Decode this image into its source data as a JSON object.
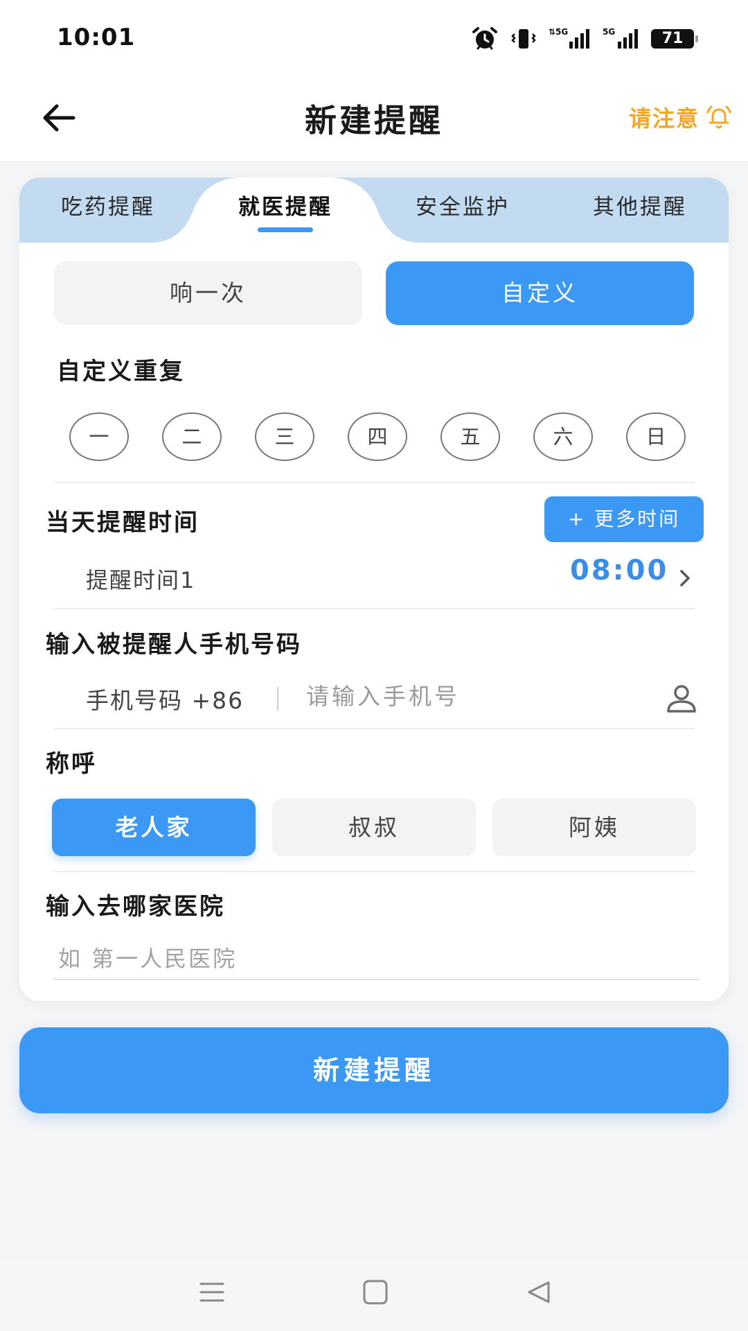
{
  "status_bar": {
    "time": "10:01",
    "icons": [
      "alarm-icon",
      "vibrate-icon",
      "signal-5g-icon",
      "signal-5g-icon"
    ],
    "battery": "71"
  },
  "header": {
    "title": "新建提醒",
    "notice_label": "请注意"
  },
  "tabs": [
    {
      "label": "吃药提醒",
      "active": false
    },
    {
      "label": "就医提醒",
      "active": true
    },
    {
      "label": "安全监护",
      "active": false
    },
    {
      "label": "其他提醒",
      "active": false
    }
  ],
  "repeat_mode": {
    "once_label": "响一次",
    "custom_label": "自定义",
    "selected": "自定义"
  },
  "custom_repeat": {
    "title": "自定义重复",
    "days": [
      "一",
      "二",
      "三",
      "四",
      "五",
      "六",
      "日"
    ]
  },
  "reminder_time": {
    "title": "当天提醒时间",
    "more_button": "+ 更多时间",
    "items": [
      {
        "label": "提醒时间1",
        "value": "08:00"
      }
    ]
  },
  "phone": {
    "title": "输入被提醒人手机号码",
    "prefix": "手机号码 +86",
    "placeholder": "请输入手机号",
    "value": ""
  },
  "salutation": {
    "title": "称呼",
    "options": [
      "老人家",
      "叔叔",
      "阿姨"
    ],
    "selected": "老人家"
  },
  "hospital": {
    "title": "输入去哪家医院",
    "placeholder": "如 第一人民医院",
    "value": ""
  },
  "submit_button": "新建提醒",
  "colors": {
    "accent": "#3b99f5",
    "tab_bar": "#c3dbf0",
    "notice": "#f5a623",
    "background": "#f4f5f7"
  },
  "nav_bar": [
    "menu-icon",
    "home-square-icon",
    "back-triangle-icon"
  ]
}
